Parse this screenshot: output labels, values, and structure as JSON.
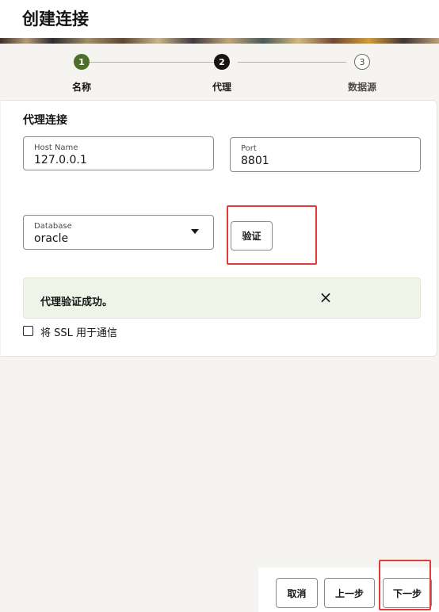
{
  "page": {
    "title": "创建连接"
  },
  "steps": [
    {
      "number": "1",
      "label": "名称",
      "state": "completed"
    },
    {
      "number": "2",
      "label": "代理",
      "state": "current"
    },
    {
      "number": "3",
      "label": "数据源",
      "state": "upcoming"
    }
  ],
  "proxy_section": {
    "title": "代理连接",
    "host": {
      "label": "Host Name",
      "value": "127.0.0.1"
    },
    "port": {
      "label": "Port",
      "value": "8801"
    },
    "database": {
      "label": "Database",
      "value": "oracle"
    },
    "verify_label": "验证"
  },
  "alert": {
    "message": "代理验证成功。",
    "close_icon": "×"
  },
  "ssl": {
    "label": "将 SSL 用于通信",
    "checked": false
  },
  "footer": {
    "cancel_label": "取消",
    "prev_label": "上一步",
    "next_label": "下一步"
  },
  "colors": {
    "step_completed": "#4d7029",
    "step_current": "#161513",
    "alert_bg": "#eef5e8",
    "highlight": "#e53a3a"
  }
}
